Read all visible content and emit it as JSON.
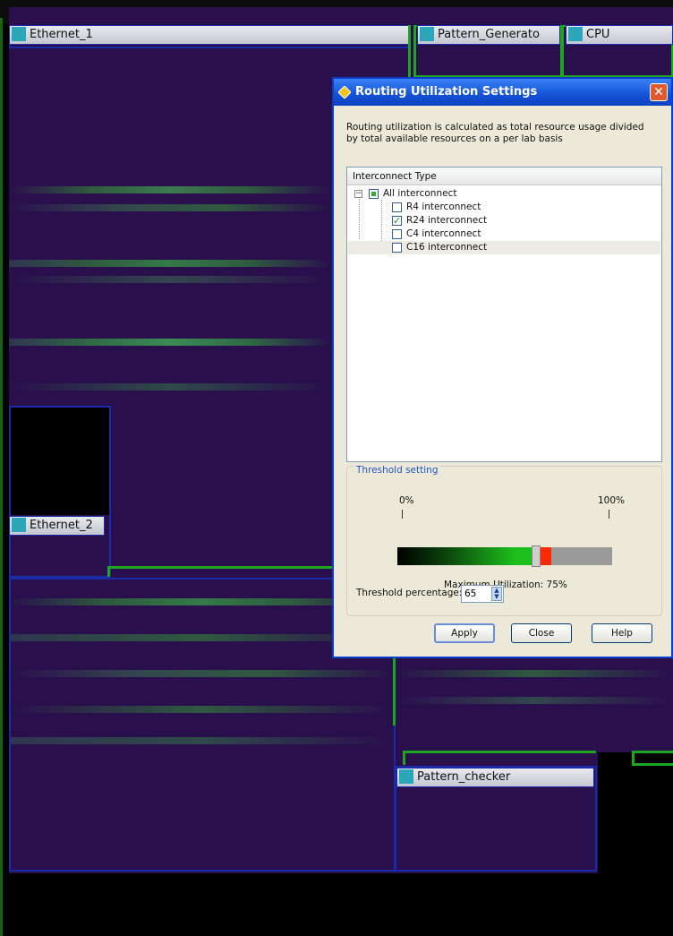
{
  "floorplan": {
    "regions": {
      "ethernet_1": "Ethernet_1",
      "pattern_generator": "Pattern_Generato",
      "cpu": "CPU",
      "ethernet_2": "Ethernet_2",
      "pattern_checker": "Pattern_checker"
    },
    "colors": {
      "background": "#2a0f4d",
      "region_border": "#1a2aa8",
      "boundary_green": "#1fa51f",
      "label_swatch": "#2aa7b8"
    }
  },
  "dialog": {
    "title": "Routing Utilization Settings",
    "close_glyph": "✕",
    "description_line1": "Routing utilization is calculated as total resource usage divided",
    "description_line2": "by total available resources on a per lab basis",
    "tree": {
      "header": "Interconnect Type",
      "root": "All interconnect",
      "items": [
        {
          "label": "R4 interconnect",
          "checked": false
        },
        {
          "label": "R24 interconnect",
          "checked": true
        },
        {
          "label": "C4 interconnect",
          "checked": false
        },
        {
          "label": "C16 interconnect",
          "checked": false
        }
      ]
    },
    "threshold": {
      "group_title": "Threshold setting",
      "min_label": "0%",
      "max_label": "100%",
      "max_util_text": "Maximum Utilization: 75%",
      "threshold_label": "Threshold percentage:",
      "threshold_value": "65",
      "slider_value_percent": 65,
      "max_util_percent": 75
    },
    "buttons": {
      "apply": "Apply",
      "close": "Close",
      "help": "Help"
    },
    "colors": {
      "titlebar": "#1551d6",
      "close_button": "#e05a2f",
      "accent_green": "#1cbf1c",
      "accent_red": "#ff2a00"
    }
  }
}
